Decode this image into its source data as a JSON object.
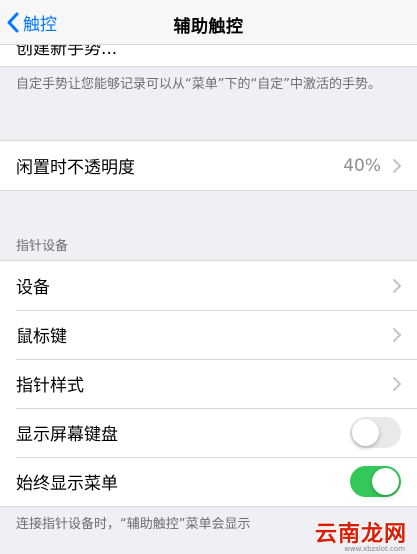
{
  "nav": {
    "back_label": "触控",
    "title": "辅助触控"
  },
  "clipped_item": {
    "label": "创建新手势..."
  },
  "custom_gesture_note": "自定手势让您能够记录可以从“菜单”下的“自定”中激活的手势。",
  "idle_opacity": {
    "label": "闲置时不透明度",
    "value": "40%"
  },
  "pointer_section": {
    "header": "指针设备",
    "items": [
      {
        "label": "设备"
      },
      {
        "label": "鼠标键"
      },
      {
        "label": "指针样式"
      }
    ],
    "toggles": [
      {
        "label": "显示屏幕键盘",
        "state": "off"
      },
      {
        "label": "始终显示菜单",
        "state": "on"
      }
    ],
    "footer": "连接指针设备时，“辅助触控”菜单会显示"
  },
  "watermark": {
    "text": "云南龙网",
    "sub": "www.xbzslot.com"
  },
  "colors": {
    "accent": "#007aff",
    "toggle_on": "#34c759",
    "toggle_off": "#e9e9eb",
    "background": "#efeff4"
  }
}
